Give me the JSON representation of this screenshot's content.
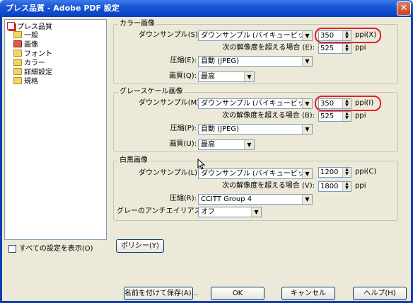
{
  "window": {
    "title": "プレス品質 - Adobe PDF 設定"
  },
  "tree": {
    "items": [
      {
        "label": "プレス品質",
        "icon": "pdf-settings-icon"
      },
      {
        "label": "一般",
        "icon": "folder-icon"
      },
      {
        "label": "画像",
        "icon": "folder-open-icon"
      },
      {
        "label": "フォント",
        "icon": "folder-icon"
      },
      {
        "label": "カラー",
        "icon": "folder-icon"
      },
      {
        "label": "詳細設定",
        "icon": "folder-icon"
      },
      {
        "label": "規格",
        "icon": "folder-icon"
      }
    ],
    "selected": "画像"
  },
  "color": {
    "title": "カラー画像",
    "down_label": "ダウンサンプル(S):",
    "down_value": "ダウンサンプル (バイキュービック法)",
    "ppi_value": "350",
    "ppi_unit": "ppi(X)",
    "above_label": "次の解像度を超える場合 (E):",
    "above_value": "525",
    "above_unit": "ppi",
    "comp_label": "圧縮(E):",
    "comp_value": "自動 (JPEG)",
    "quality_label": "画質(Q):",
    "quality_value": "最高"
  },
  "gray": {
    "title": "グレースケール画像",
    "down_label": "ダウンサンプル(M):",
    "down_value": "ダウンサンプル (バイキュービック法)",
    "ppi_value": "350",
    "ppi_unit": "ppi(I)",
    "above_label": "次の解像度を超える場合 (B):",
    "above_value": "525",
    "above_unit": "ppi",
    "comp_label": "圧縮(P):",
    "comp_value": "自動 (JPEG)",
    "quality_label": "画質(U):",
    "quality_value": "最高"
  },
  "mono": {
    "title": "白黒画像",
    "down_label": "ダウンサンプル(L):",
    "down_value": "ダウンサンプル (バイキュービック法)",
    "ppi_value": "1200",
    "ppi_unit": "ppi(C)",
    "above_label": "次の解像度を超える場合 (V):",
    "above_value": "1800",
    "above_unit": "ppi",
    "comp_label": "圧縮(R):",
    "comp_value": "CCITT Group 4",
    "aa_label": "グレーのアンチエイリアス(G):",
    "aa_value": "オフ"
  },
  "show_all_label": "すべての設定を表示(O)",
  "buttons": {
    "policy": "ポリシー(Y)",
    "save_as": "名前を付けて保存(A)...",
    "ok": "OK",
    "cancel": "キャンセル",
    "help": "ヘルプ(H)"
  }
}
